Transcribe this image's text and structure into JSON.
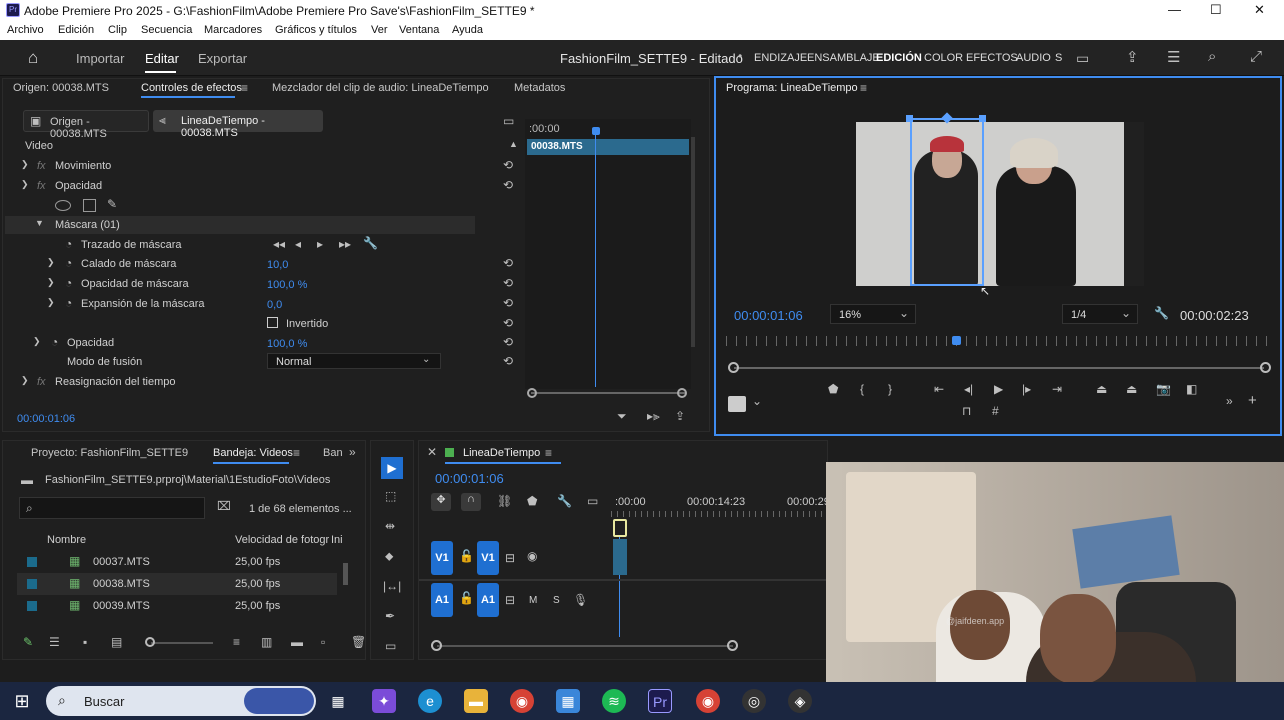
{
  "window": {
    "title": "Adobe Premiere Pro 2025 - G:\\FashionFilm\\Adobe Premiere Pro Save's\\FashionFilm_SETTE9 *",
    "min": "—",
    "max": "☐",
    "close": "✕"
  },
  "menu": [
    "Archivo",
    "Edición",
    "Clip",
    "Secuencia",
    "Marcadores",
    "Gráficos y títulos",
    "Ver",
    "Ventana",
    "Ayuda"
  ],
  "topbar": {
    "tabs": [
      "Importar",
      "Editar",
      "Exportar"
    ],
    "project_title": "FashionFilm_SETTE9 - Editado",
    "workspaces": [
      "ENDIZAJE",
      "ENSAMBLAJE",
      "EDICIÓN",
      "COLOR",
      "EFECTOS",
      "AUDIO",
      "S"
    ]
  },
  "effects_panel": {
    "tabs": [
      "Origen: 00038.MTS",
      "Controles de efectos",
      "Mezclador del clip de audio: LineaDeTiempo",
      "Metadatos"
    ],
    "subtabs": [
      "Origen - 00038.MTS",
      "LineaDeTiempo - 00038.MTS"
    ],
    "section": "Video",
    "rows": {
      "movimiento": "Movimiento",
      "opacidad_group": "Opacidad",
      "mascara": "Máscara (01)",
      "trazado": "Trazado de máscara",
      "calado": "Calado de máscara",
      "calado_val": "10,0",
      "opac_masc": "Opacidad de máscara",
      "opac_masc_val": "100,0 %",
      "expansion": "Expansión de la máscara",
      "expansion_val": "0,0",
      "invertido": "Invertido",
      "opacidad": "Opacidad",
      "opacidad_val": "100,0 %",
      "modo": "Modo de fusión",
      "modo_val": "Normal",
      "reasig": "Reasignación del tiempo"
    },
    "mini_timeline_start": ":00:00",
    "clip_label": "00038.MTS",
    "timecode": "00:00:01:06"
  },
  "program_monitor": {
    "title": "Programa: LineaDeTiempo",
    "timecode": "00:00:01:06",
    "zoom": "16%",
    "resolution": "1/4",
    "duration": "00:00:02:23"
  },
  "project_panel": {
    "tabs": [
      "Proyecto: FashionFilm_SETTE9",
      "Bandeja: Videos",
      "Ban"
    ],
    "path": "FashionFilm_SETTE9.prproj\\Material\\1EstudioFoto\\Videos",
    "count": "1 de 68 elementos ...",
    "columns": [
      "Nombre",
      "Velocidad de fotogr",
      "Ini"
    ],
    "rows": [
      {
        "name": "00037.MTS",
        "fps": "25,00 fps"
      },
      {
        "name": "00038.MTS",
        "fps": "25,00 fps"
      },
      {
        "name": "00039.MTS",
        "fps": "25,00 fps"
      }
    ]
  },
  "timeline": {
    "title": "LineaDeTiempo",
    "timecode": "00:00:01:06",
    "ruler": [
      ":00:00",
      "00:00:14:23",
      "00:00:29"
    ],
    "tracks": {
      "v1a": "V1",
      "v1b": "V1",
      "a1a": "A1",
      "a1b": "A1"
    }
  },
  "webcam_overlay": {
    "watermark": "@jaifdeen.app"
  },
  "taskbar": {
    "search": "Buscar",
    "apps": [
      "start-icon",
      "search-icon",
      "widget-icon",
      "task-view-icon",
      "copilot-icon",
      "edge-icon",
      "explorer-icon",
      "chrome-icon",
      "store-icon",
      "spotify-icon",
      "premiere-icon",
      "chrome-profile-icon",
      "app-icon",
      "app2-icon"
    ]
  }
}
